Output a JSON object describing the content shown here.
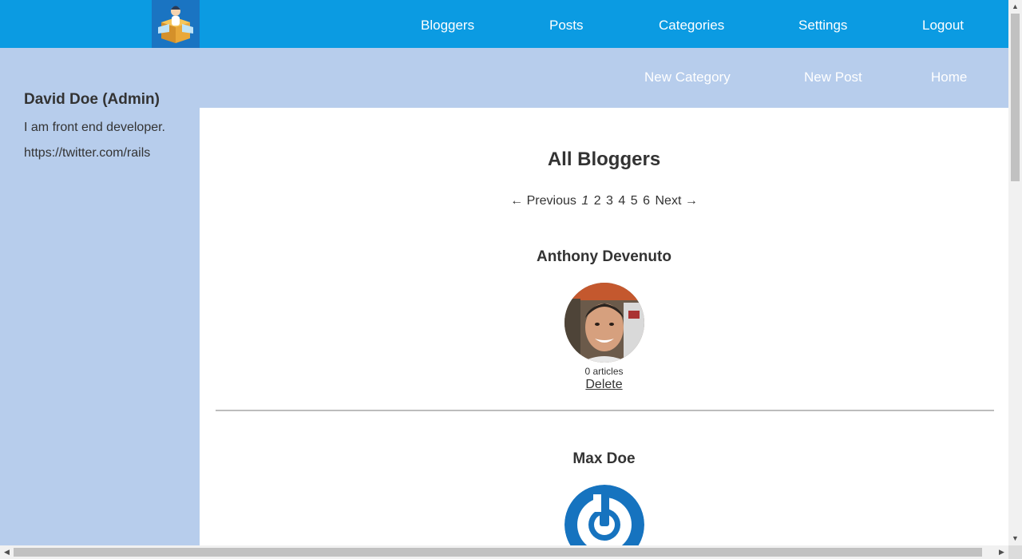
{
  "header": {
    "logo_icon": "blogger-box-logo-icon",
    "nav": [
      {
        "label": "Bloggers"
      },
      {
        "label": "Posts"
      },
      {
        "label": "Categories"
      },
      {
        "label": "Settings"
      },
      {
        "label": "Logout"
      }
    ]
  },
  "subnav": [
    {
      "label": "New Category"
    },
    {
      "label": "New Post"
    },
    {
      "label": "Home"
    }
  ],
  "sidebar": {
    "name": "David Doe (Admin)",
    "bio": "I am front end developer.",
    "link": "https://twitter.com/rails"
  },
  "main": {
    "title": "All Bloggers",
    "pagination": {
      "previous": "← Previous",
      "pages": [
        "1",
        "2",
        "3",
        "4",
        "5",
        "6"
      ],
      "current": "1",
      "next": "Next →"
    },
    "bloggers": [
      {
        "name": "Anthony Devenuto",
        "articles": "0 articles",
        "delete_label": "Delete",
        "avatar_icon": "user-photo-avatar"
      },
      {
        "name": "Max Doe",
        "avatar_icon": "power-logo-avatar"
      }
    ]
  },
  "colors": {
    "topbar": "#0b9be2",
    "background": "#b7cdec",
    "content": "#ffffff",
    "text": "#333333"
  }
}
